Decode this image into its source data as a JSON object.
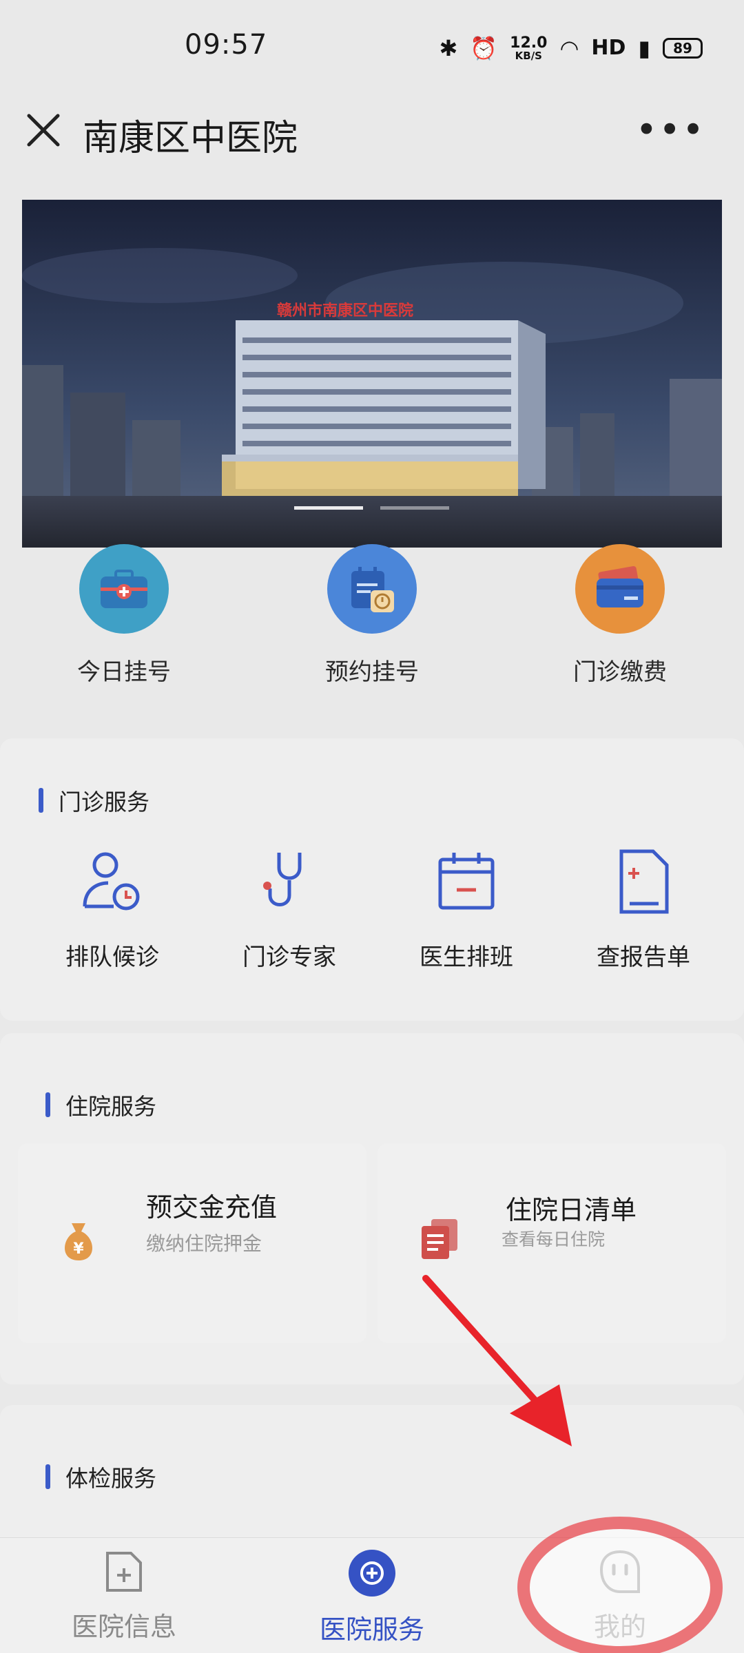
{
  "status_bar": {
    "time": "09:57",
    "net_speed_value": "12.0",
    "net_speed_unit": "KB/S",
    "hd_label": "HD",
    "battery": "89"
  },
  "nav": {
    "title": "南康区中医院"
  },
  "banner": {
    "building_sign": "赣州市南康区中医院"
  },
  "quick_actions": [
    {
      "label": "今日挂号",
      "icon": "medical-kit-icon",
      "color": "#3fa0c6"
    },
    {
      "label": "预约挂号",
      "icon": "calendar-clock-icon",
      "color": "#4b86d9"
    },
    {
      "label": "门诊缴费",
      "icon": "wallet-card-icon",
      "color": "#e7913c"
    }
  ],
  "outpatient": {
    "title": "门诊服务",
    "items": [
      {
        "label": "排队候诊",
        "icon": "user-clock-icon"
      },
      {
        "label": "门诊专家",
        "icon": "stethoscope-icon"
      },
      {
        "label": "医生排班",
        "icon": "calendar-minus-icon"
      },
      {
        "label": "查报告单",
        "icon": "report-document-icon"
      }
    ]
  },
  "inpatient": {
    "title": "住院服务",
    "cards": [
      {
        "title": "预交金充值",
        "subtitle": "缴纳住院押金",
        "icon": "money-bag-icon"
      },
      {
        "title": "住院日清单",
        "subtitle": "查看每日住院",
        "icon": "daily-list-icon"
      }
    ]
  },
  "checkup": {
    "title": "体检服务"
  },
  "tabbar": {
    "tabs": [
      {
        "label": "医院信息",
        "icon": "hospital-info-icon",
        "active": false
      },
      {
        "label": "医院服务",
        "icon": "hospital-service-icon",
        "active": true
      },
      {
        "label": "我的",
        "icon": "smiley-face-icon",
        "active": false
      }
    ]
  },
  "colors": {
    "accent": "#3552c4",
    "annotation": "#e8232a"
  }
}
